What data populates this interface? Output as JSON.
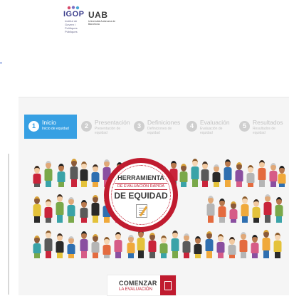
{
  "header": {
    "logo_igop": "IGOP",
    "logo_igop_sub": "Institut de Govern i Polítiques Públiques",
    "logo_uab": "UAB",
    "logo_uab_sub": "Universitat Autònoma de Barcelona"
  },
  "steps": [
    {
      "num": "1",
      "title": "Inicio",
      "sub": "Inicio de equidad",
      "active": true
    },
    {
      "num": "2",
      "title": "Presentación",
      "sub": "Presentación de equidad",
      "active": false
    },
    {
      "num": "3",
      "title": "Definiciones",
      "sub": "Definiciones de equidad",
      "active": false
    },
    {
      "num": "4",
      "title": "Evaluación",
      "sub": "Evaluación de equidad",
      "active": false
    },
    {
      "num": "5",
      "title": "Resultados",
      "sub": "Resultados de equidad",
      "active": false
    }
  ],
  "badge": {
    "line1": "HERRAMIENTA",
    "line2": "DE EVALUACIÓN RÁPIDA",
    "line3": "DE EQUIDAD"
  },
  "start_button": {
    "label": "COMENZAR",
    "sub": "LA EVALUACIÓN"
  },
  "colors": {
    "accent_blue": "#37a0e3",
    "brand_red": "#c01b2f"
  }
}
